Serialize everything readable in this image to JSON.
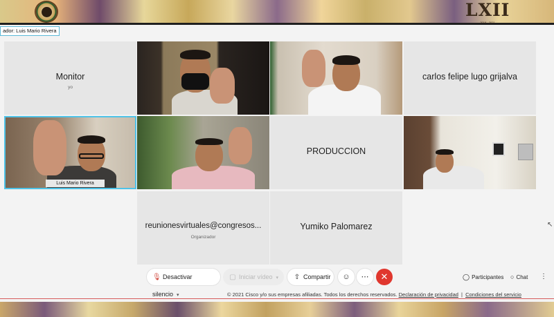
{
  "banner": {
    "logo_text": "LXII",
    "logo_years": "2018 - 2021"
  },
  "presenter": {
    "label": "ador: Luis Mario Rivera"
  },
  "tiles": {
    "monitor": {
      "name": "Monitor",
      "sub": "yo"
    },
    "carlos": {
      "name": "carlos felipe lugo grijalva"
    },
    "luis": {
      "tag": "Luis Mario Rivera"
    },
    "produccion": {
      "name": "PRODUCCION"
    },
    "reuniones": {
      "name": "reunionesvirtuales@congresos...",
      "sub": "Organizador"
    },
    "yumiko": {
      "name": "Yumiko Palomarez"
    }
  },
  "controls": {
    "mute": "Desactivar silencio",
    "video": "Iniciar vídeo",
    "share": "Compartir",
    "participants": "Participantes",
    "chat": "Chat"
  },
  "footer": {
    "copyright": "© 2021 Cisco y/o sus empresas afiliadas. Todos los derechos reservados.",
    "privacy": "Declaración de privacidad",
    "separator": "|",
    "terms": "Condiciones del servicio"
  },
  "colors": {
    "accent": "#4ec3e8",
    "end_call": "#e0372e",
    "tile_bg": "#e6e6e6"
  }
}
